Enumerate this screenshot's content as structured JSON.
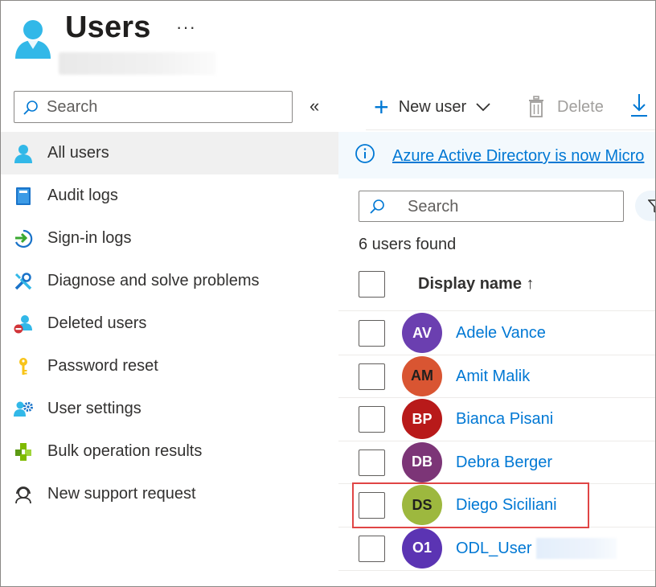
{
  "header": {
    "title": "Users",
    "more_label": "···",
    "icon": "user-icon"
  },
  "sidebar": {
    "search_placeholder": "Search",
    "collapse_label": "«",
    "items": [
      {
        "label": "All users",
        "icon": "user-icon",
        "active": true
      },
      {
        "label": "Audit logs",
        "icon": "book-icon"
      },
      {
        "label": "Sign-in logs",
        "icon": "sign-in-icon"
      },
      {
        "label": "Diagnose and solve problems",
        "icon": "wrench-icon"
      },
      {
        "label": "Deleted users",
        "icon": "deleted-user-icon"
      },
      {
        "label": "Password reset",
        "icon": "key-icon"
      },
      {
        "label": "User settings",
        "icon": "user-settings-icon"
      },
      {
        "label": "Bulk operation results",
        "icon": "cubes-icon"
      },
      {
        "label": "New support request",
        "icon": "support-icon"
      }
    ]
  },
  "toolbar": {
    "new_user_label": "New user",
    "delete_label": "Delete"
  },
  "banner": {
    "text": "Azure Active Directory is now Micro"
  },
  "main": {
    "search_placeholder": "Search",
    "count_text": "6 users found",
    "column_header": "Display name ↑"
  },
  "users": [
    {
      "initials": "AV",
      "name": "Adele Vance",
      "color": "#6b3fb0"
    },
    {
      "initials": "AM",
      "name": "Amit Malik",
      "color": "#d95532",
      "dark_text": true
    },
    {
      "initials": "BP",
      "name": "Bianca Pisani",
      "color": "#b81a1a"
    },
    {
      "initials": "DB",
      "name": "Debra Berger",
      "color": "#7c3577"
    },
    {
      "initials": "DS",
      "name": "Diego Siciliani",
      "color": "#9db83e",
      "dark_text": true,
      "highlighted": true
    },
    {
      "initials": "O1",
      "name": "ODL_User",
      "color": "#5b34b3",
      "redacted_suffix": true
    }
  ],
  "colors": {
    "accent": "#0078d4",
    "highlight_box": "#e04545",
    "banner_bg": "#f3f9fd"
  }
}
